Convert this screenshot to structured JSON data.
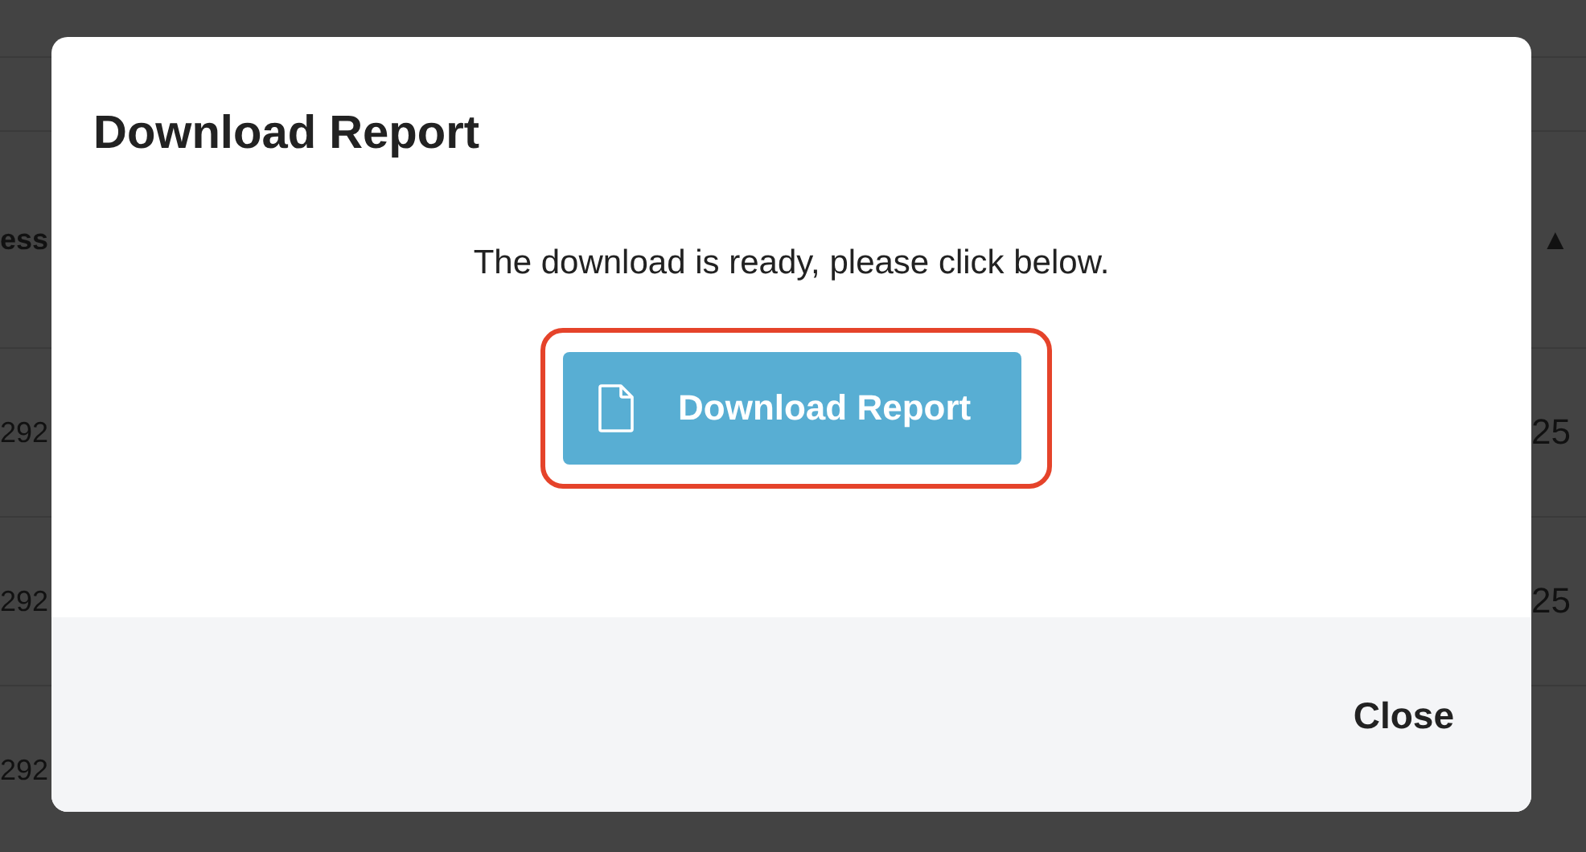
{
  "background_table": {
    "header": {
      "column_1": "ess",
      "column_2": "▲"
    },
    "rows": [
      {
        "column_1": "292",
        "column_2": "25"
      },
      {
        "column_1": "292",
        "column_2": "25"
      },
      {
        "column_1": "292"
      }
    ]
  },
  "dialog": {
    "title": "Download Report",
    "message": "The download is ready, please click below.",
    "download_button": {
      "label": "Download Report",
      "highlighted": true
    },
    "footer_buttons": [
      "Close"
    ]
  }
}
